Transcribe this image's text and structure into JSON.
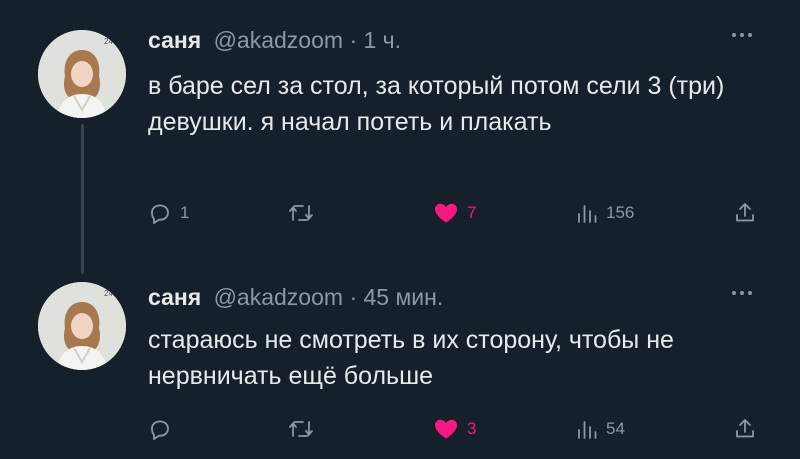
{
  "tweets": [
    {
      "name": "саня",
      "handle": "@akadzoom",
      "separator": "·",
      "time": "1 ч.",
      "text": "в баре сел за стол, за который потом сели 3 (три) девушки. я начал потеть и плакать",
      "reply_count": "1",
      "retweet_count": "",
      "like_count": "7",
      "view_count": "156"
    },
    {
      "name": "саня",
      "handle": "@akadzoom",
      "separator": "·",
      "time": "45 мин.",
      "text": "стараюсь не смотреть в их сторону, чтобы не нервничать ещё больше",
      "reply_count": "",
      "retweet_count": "",
      "like_count": "3",
      "view_count": "54"
    }
  ],
  "colors": {
    "background": "#15202b",
    "text": "#e7e9ea",
    "muted": "#8b98a5",
    "like": "#f91880",
    "thread_line": "#38444d"
  },
  "icons": [
    "avatar",
    "more-icon",
    "reply-icon",
    "retweet-icon",
    "heart-icon",
    "views-icon",
    "share-icon"
  ]
}
